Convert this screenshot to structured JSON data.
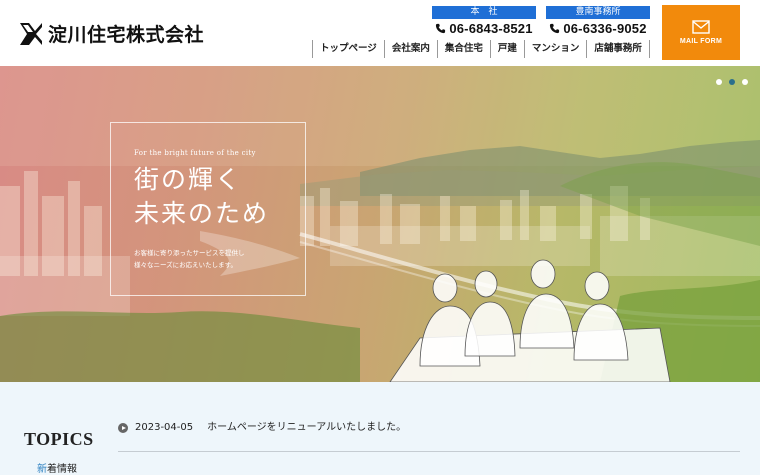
{
  "header": {
    "logo_text": "淀川住宅株式会社",
    "contacts": [
      {
        "label": "本　社",
        "phone": "06-6843-8521"
      },
      {
        "label": "豊南事務所",
        "phone": "06-6336-9052"
      }
    ],
    "mail_button_label": "MAIL FORM",
    "nav": [
      "トップページ",
      "会社案内",
      "集合住宅",
      "戸建",
      "マンション",
      "店舗事務所"
    ]
  },
  "hero": {
    "subtitle": "For the bright future of the city",
    "title_line1": "街の輝く",
    "title_line2": "未来のため",
    "desc_line1": "お客様に寄り添ったサービスを提供し",
    "desc_line2": "様々なニーズにお応えいたします。",
    "slide_count": 3,
    "active_slide": 2
  },
  "topics": {
    "title": "TOPICS",
    "subtitle_accent": "新",
    "subtitle_rest": "着情報",
    "items": [
      {
        "date": "2023-04-05",
        "text": "ホームページをリニューアルいたしました。"
      }
    ]
  },
  "colors": {
    "accent_blue": "#1f6fd6",
    "mail_orange": "#f28a0c",
    "topics_bg": "#eef6fb"
  }
}
